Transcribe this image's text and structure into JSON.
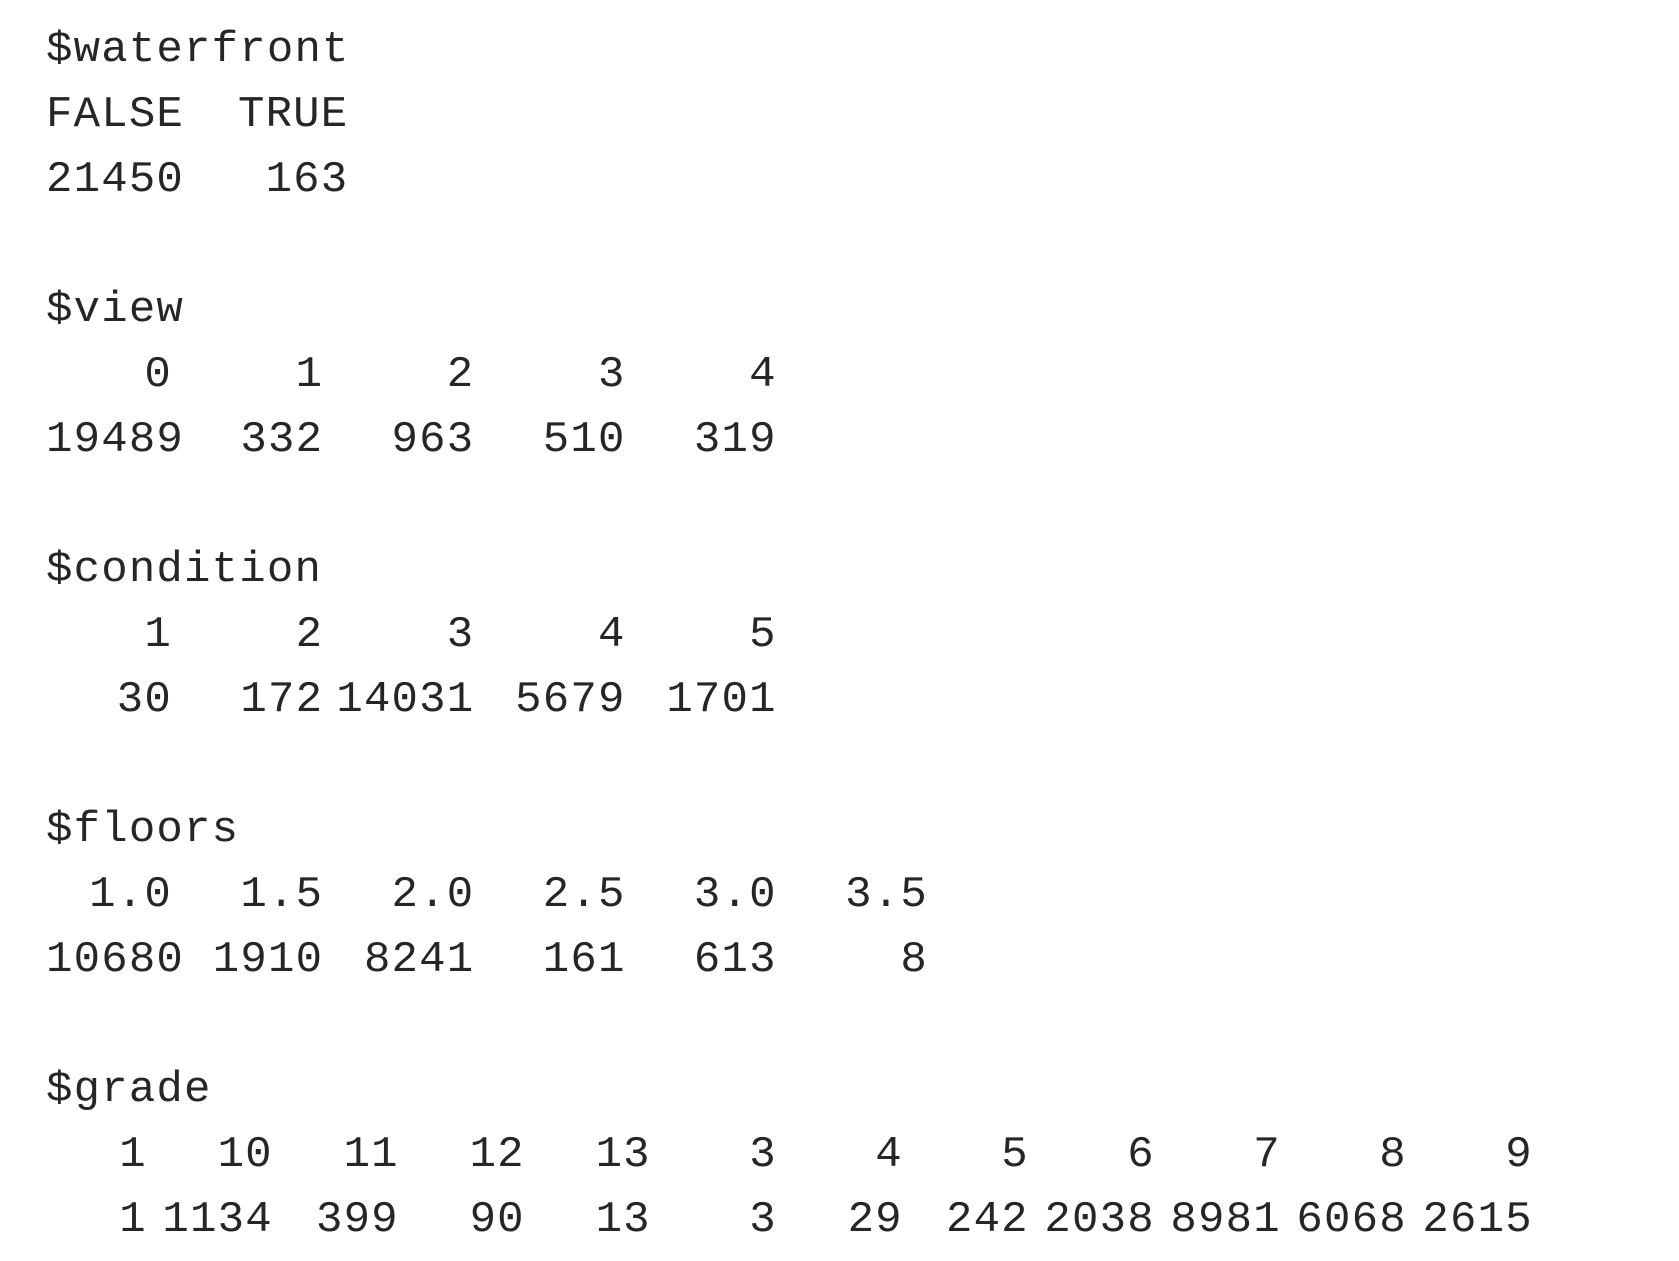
{
  "tables": [
    {
      "name": "$waterfront",
      "widths": [
        5,
        7
      ],
      "keys": [
        "FALSE",
        "TRUE"
      ],
      "counts": [
        "21450",
        "163"
      ]
    },
    {
      "name": "$view",
      "widths": [
        5,
        6,
        6,
        6,
        6
      ],
      "keys": [
        "0",
        "1",
        "2",
        "3",
        "4"
      ],
      "counts": [
        "19489",
        "332",
        "963",
        "510",
        "319"
      ]
    },
    {
      "name": "$condition",
      "widths": [
        5,
        6,
        6,
        6,
        6
      ],
      "keys": [
        "1",
        "2",
        "3",
        "4",
        "5"
      ],
      "counts": [
        "30",
        "172",
        "14031",
        "5679",
        "1701"
      ]
    },
    {
      "name": "$floors",
      "widths": [
        5,
        6,
        6,
        6,
        6,
        6
      ],
      "keys": [
        "1.0",
        "1.5",
        "2.0",
        "2.5",
        "3.0",
        "3.5"
      ],
      "counts": [
        "10680",
        "1910",
        "8241",
        "161",
        "613",
        "8"
      ]
    },
    {
      "name": "$grade",
      "widths": [
        4,
        5,
        5,
        5,
        5,
        5,
        5,
        5,
        5,
        5,
        5,
        5
      ],
      "keys": [
        "1",
        "10",
        "11",
        "12",
        "13",
        "3",
        "4",
        "5",
        "6",
        "7",
        "8",
        "9"
      ],
      "counts": [
        "1",
        "1134",
        "399",
        "90",
        "13",
        "3",
        "29",
        "242",
        "2038",
        "8981",
        "6068",
        "2615"
      ]
    }
  ]
}
